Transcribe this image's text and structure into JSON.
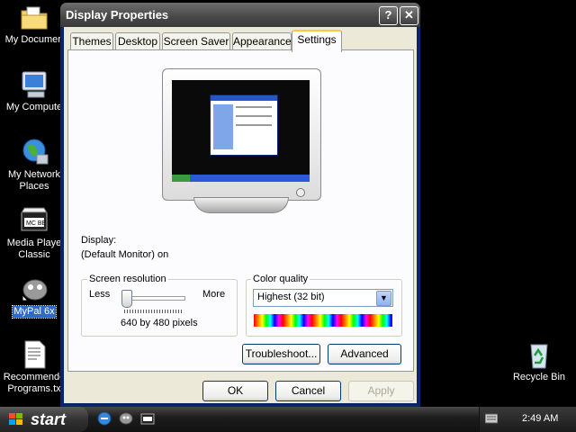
{
  "desktop": {
    "icons": [
      {
        "label": "My Documen",
        "icon": "folder-documents-icon"
      },
      {
        "label": "My Compute",
        "icon": "computer-icon"
      },
      {
        "label": "My Network Places",
        "label_line1": "My Network",
        "label_line2": "Places",
        "icon": "network-globe-icon"
      },
      {
        "label_line1": "Media Playe",
        "label_line2": "Classic",
        "icon": "media-player-icon"
      },
      {
        "label": "MyPal 6x",
        "icon": "mypal-icon"
      },
      {
        "label_line1": "Recommende",
        "label_line2": "Programs.tx",
        "icon": "text-file-icon"
      },
      {
        "label": "Recycle Bin",
        "icon": "recycle-bin-icon"
      }
    ]
  },
  "window": {
    "title": "Display Properties",
    "help_label": "?",
    "close_label": "✕",
    "tabs": [
      "Themes",
      "Desktop",
      "Screen Saver",
      "Appearance",
      "Settings"
    ],
    "active_tab": "Settings",
    "display_label": "Display:",
    "display_value": "(Default Monitor) on",
    "resolution": {
      "group_title": "Screen resolution",
      "less": "Less",
      "more": "More",
      "value": "640 by 480 pixels"
    },
    "color": {
      "group_title": "Color quality",
      "selected": "Highest (32 bit)"
    },
    "buttons": {
      "troubleshoot": "Troubleshoot...",
      "advanced": "Advanced",
      "ok": "OK",
      "cancel": "Cancel",
      "apply": "Apply"
    }
  },
  "taskbar": {
    "start_label": "start",
    "clock": "2:49 AM"
  }
}
